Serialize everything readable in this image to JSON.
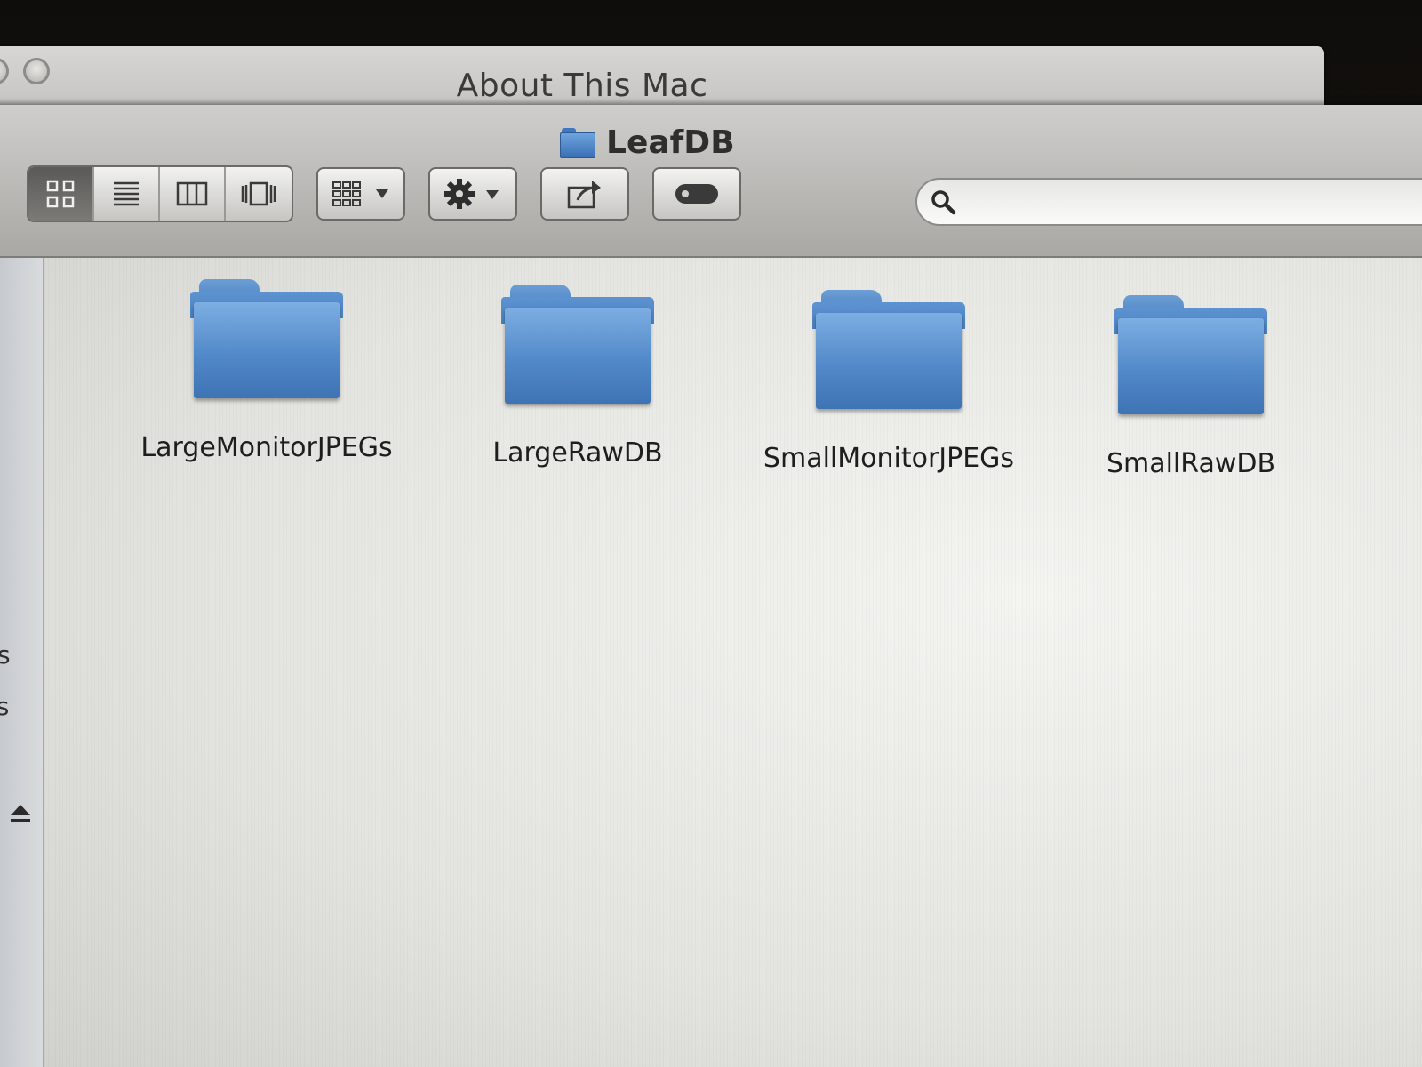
{
  "background_window": {
    "title": "About This Mac"
  },
  "window": {
    "title": "LeafDB",
    "title_icon": "folder-icon"
  },
  "toolbar": {
    "view_buttons": [
      {
        "name": "icon-view",
        "icon": "grid-icon",
        "active": true
      },
      {
        "name": "list-view",
        "icon": "list-icon",
        "active": false
      },
      {
        "name": "column-view",
        "icon": "columns-icon",
        "active": false
      },
      {
        "name": "cover-flow-view",
        "icon": "coverflow-icon",
        "active": false
      }
    ],
    "arrange_icon": "arrange-icon",
    "action_icon": "gear-icon",
    "share_icon": "share-icon",
    "tags_icon": "tag-icon"
  },
  "search": {
    "icon": "search-icon",
    "value": ""
  },
  "sidebar": {
    "partial_items": [
      "ts",
      "ls"
    ],
    "eject_icon": "eject-icon"
  },
  "items": [
    {
      "name": "LargeMonitorJPEGs",
      "type": "folder"
    },
    {
      "name": "LargeRawDB",
      "type": "folder"
    },
    {
      "name": "SmallMonitorJPEGs",
      "type": "folder"
    },
    {
      "name": "SmallRawDB",
      "type": "folder"
    }
  ],
  "colors": {
    "folder_blue": "#5289c9",
    "toolbar_gray": "#b9b8b5",
    "content_bg": "#e8e8e5"
  }
}
